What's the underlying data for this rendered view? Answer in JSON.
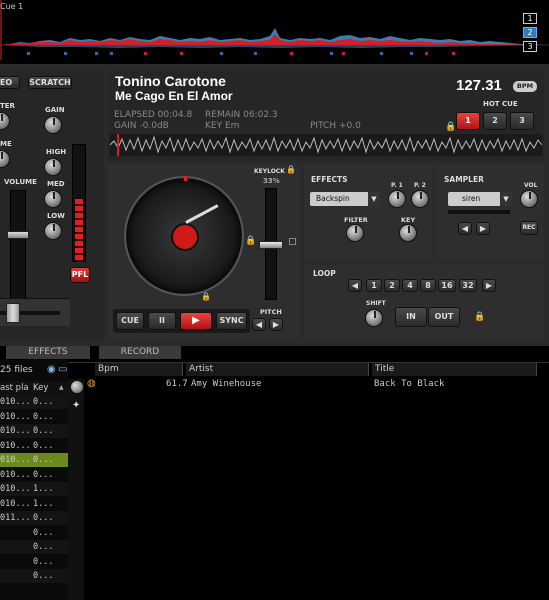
{
  "overview": {
    "cue_label": "Cue 1",
    "deck_buttons": [
      "1",
      "2",
      "3"
    ],
    "active_deck": "2"
  },
  "mixer": {
    "labels": {
      "eo": "EO",
      "scratch": "SCRATCH",
      "ter": "TER",
      "me": "ME",
      "volume": "VOLUME",
      "gain": "GAIN",
      "high": "HIGH",
      "med": "MED",
      "low": "LOW",
      "pfl": "PFL"
    }
  },
  "track": {
    "artist": "Tonino Carotone",
    "title": "Me Cago En El Amor",
    "bpm": "127.31",
    "bpm_badge": "BPM",
    "elapsed": "ELAPSED 00:04.8",
    "remain": "REMAIN 06:02.3",
    "gain": "GAIN -0.0dB",
    "key": "KEY Em",
    "pitch": "PITCH +0.0"
  },
  "hotcue": {
    "title": "HOT CUE",
    "buttons": [
      "1",
      "2",
      "3"
    ]
  },
  "deck": {
    "keylock": "KEYLOCK",
    "keylock_pct": "33%",
    "pitch_label": "PITCH",
    "transport": {
      "cue": "CUE",
      "pause": "II",
      "play": "▶",
      "sync": "SYNC"
    }
  },
  "effects": {
    "title": "EFFECTS",
    "selected": "Backspin",
    "p1": "P. 1",
    "p2": "P. 2",
    "filter": "FILTER",
    "key": "KEY"
  },
  "sampler": {
    "title": "SAMPLER",
    "selected": "siren",
    "vol": "VOL",
    "rec": "REC"
  },
  "loop": {
    "title": "LOOP",
    "sizes": [
      "1",
      "2",
      "4",
      "8",
      "16",
      "32"
    ],
    "shift": "SHIFT",
    "in": "IN",
    "out": "OUT"
  },
  "tabs": [
    "EFFECTS",
    "RECORD"
  ],
  "browser": {
    "files_count": "25 files",
    "side_headers": [
      "ast pla",
      "Key"
    ],
    "side_rows": [
      [
        "010...",
        "0..."
      ],
      [
        "010...",
        "0..."
      ],
      [
        "010...",
        "0..."
      ],
      [
        "010...",
        "0..."
      ],
      [
        "010...",
        "0..."
      ],
      [
        "010...",
        "0..."
      ],
      [
        "010...",
        "1..."
      ],
      [
        "010...",
        "1..."
      ],
      [
        "011...",
        "0..."
      ],
      [
        "",
        "0..."
      ],
      [
        "",
        "0..."
      ],
      [
        "",
        "0..."
      ],
      [
        "",
        "0..."
      ]
    ],
    "columns": [
      "Bpm",
      "Artist",
      "Title"
    ],
    "rows": [
      {
        "bpm": "61.7",
        "artist": "Amy Winehouse",
        "title": "Back To Black"
      }
    ]
  },
  "colors": {
    "accent_red": "#e0242b",
    "waveform_blue": "#4aa3d9",
    "selected_row": "#6a8a1e"
  }
}
